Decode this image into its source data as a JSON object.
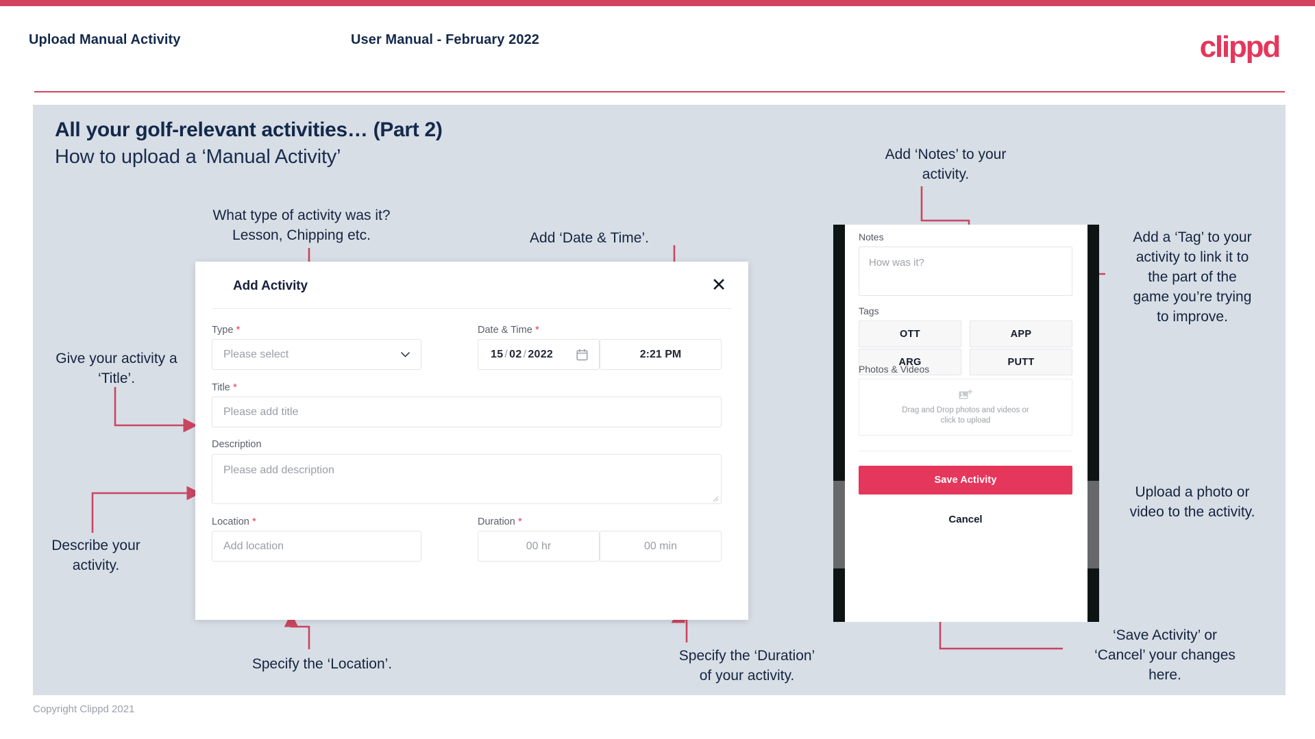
{
  "brand": {
    "name": "clippd",
    "accent": "#e5365c",
    "accent_dark": "#d2445e",
    "navy": "#13294b",
    "slide_bg": "#d8dee6"
  },
  "header": {
    "left_title": "Upload Manual Activity",
    "center_title": "User Manual - February 2022",
    "logo": "clippd"
  },
  "slide": {
    "title": "All your golf-relevant activities… (Part 2)",
    "subtitle": "How to upload a ‘Manual Activity’"
  },
  "annotations": {
    "type": "What type of activity was it?\nLesson, Chipping etc.",
    "date_time": "Add ‘Date & Time’.",
    "title": "Give your activity a\n‘Title’.",
    "description": "Describe your\nactivity.",
    "location": "Specify the ‘Location’.",
    "duration": "Specify the ‘Duration’\nof your activity.",
    "notes": "Add ‘Notes’ to your\nactivity.",
    "tags": "Add a ‘Tag’ to your\nactivity to link it to\nthe part of the\ngame you’re trying\nto improve.",
    "photos": "Upload a photo or\nvideo to the activity.",
    "save_cancel": "‘Save Activity’ or\n‘Cancel’ your changes\nhere."
  },
  "dialog": {
    "title": "Add Activity",
    "close_icon": "close-icon",
    "fields": {
      "type": {
        "label": "Type",
        "required": true,
        "placeholder": "Please select",
        "value": "",
        "icon": "chevron-down-icon"
      },
      "date_time": {
        "label": "Date & Time",
        "required": true,
        "day": "15",
        "month": "02",
        "year": "2022",
        "separator": "/",
        "calendar_icon": "calendar-icon",
        "time": "2:21 PM"
      },
      "title": {
        "label": "Title",
        "required": true,
        "placeholder": "Please add title",
        "value": ""
      },
      "description": {
        "label": "Description",
        "required": false,
        "placeholder": "Please add description",
        "value": ""
      },
      "location": {
        "label": "Location",
        "required": true,
        "placeholder": "Add location",
        "value": ""
      },
      "duration": {
        "label": "Duration",
        "required": true,
        "hours_placeholder": "00 hr",
        "minutes_placeholder": "00 min"
      }
    }
  },
  "phone": {
    "notes": {
      "label": "Notes",
      "placeholder": "How was it?",
      "value": ""
    },
    "tags": {
      "label": "Tags",
      "items": [
        "OTT",
        "APP",
        "ARG",
        "PUTT"
      ]
    },
    "photos": {
      "label": "Photos & Videos",
      "icon": "add-image-icon",
      "dropzone_line1": "Drag and Drop photos and videos or",
      "dropzone_line2": "click to upload"
    },
    "actions": {
      "save_label": "Save Activity",
      "cancel_label": "Cancel"
    }
  },
  "footer": {
    "copyright": "Copyright Clippd 2021"
  }
}
